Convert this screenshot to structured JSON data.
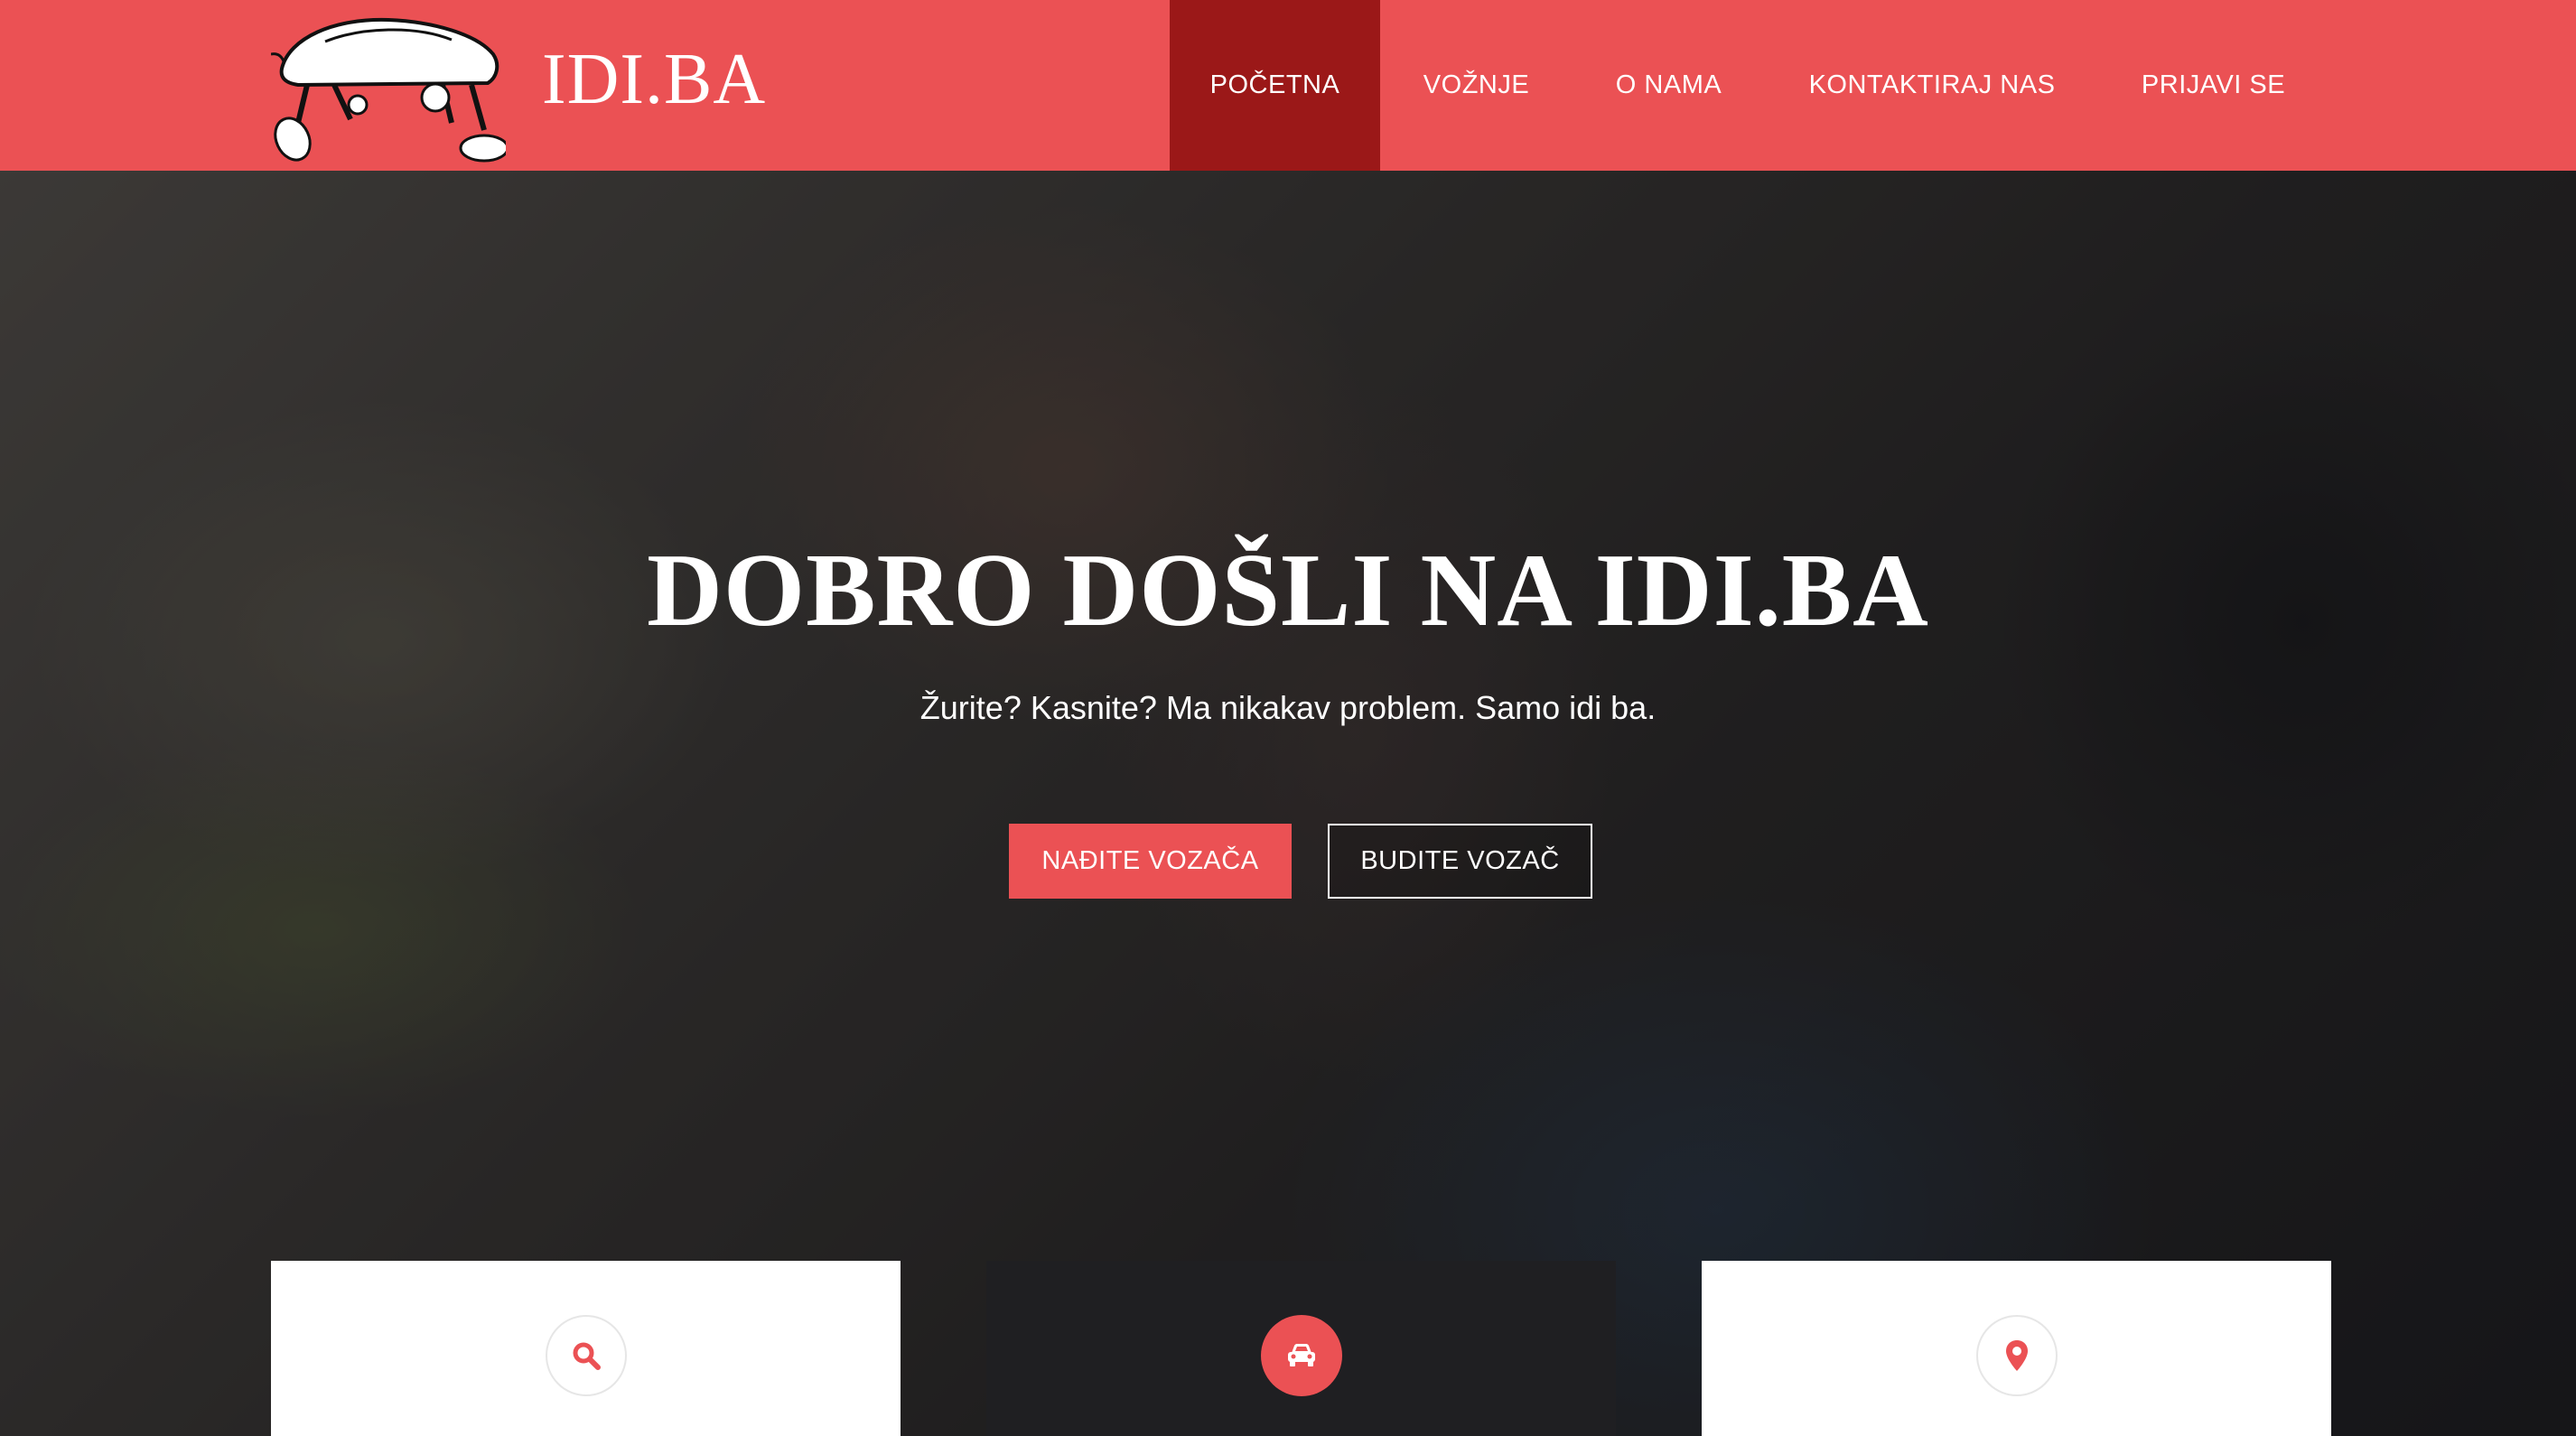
{
  "brand": {
    "name": "IDI.BA",
    "logo_icon": "running-car-logo"
  },
  "nav": {
    "items": [
      {
        "label": "POČETNA",
        "active": true
      },
      {
        "label": "VOŽNJE",
        "active": false
      },
      {
        "label": "O NAMA",
        "active": false
      },
      {
        "label": "KONTAKTIRAJ NAS",
        "active": false
      },
      {
        "label": "PRIJAVI SE",
        "active": false
      }
    ]
  },
  "hero": {
    "title": "DOBRO DOŠLI NA IDI.BA",
    "subtitle": "Žurite? Kasnite? Ma nikakav problem. Samo idi ba.",
    "primary_button": "NAĐITE VOZAČA",
    "secondary_button": "BUDITE VOZAČ"
  },
  "features": [
    {
      "icon": "search-icon",
      "theme": "light"
    },
    {
      "icon": "car-icon",
      "theme": "dark"
    },
    {
      "icon": "map-pin-icon",
      "theme": "light"
    }
  ],
  "colors": {
    "accent": "#eb5154",
    "nav_active": "#9b1818",
    "dark_card": "#1f1f22",
    "text_light": "#ffffff"
  }
}
